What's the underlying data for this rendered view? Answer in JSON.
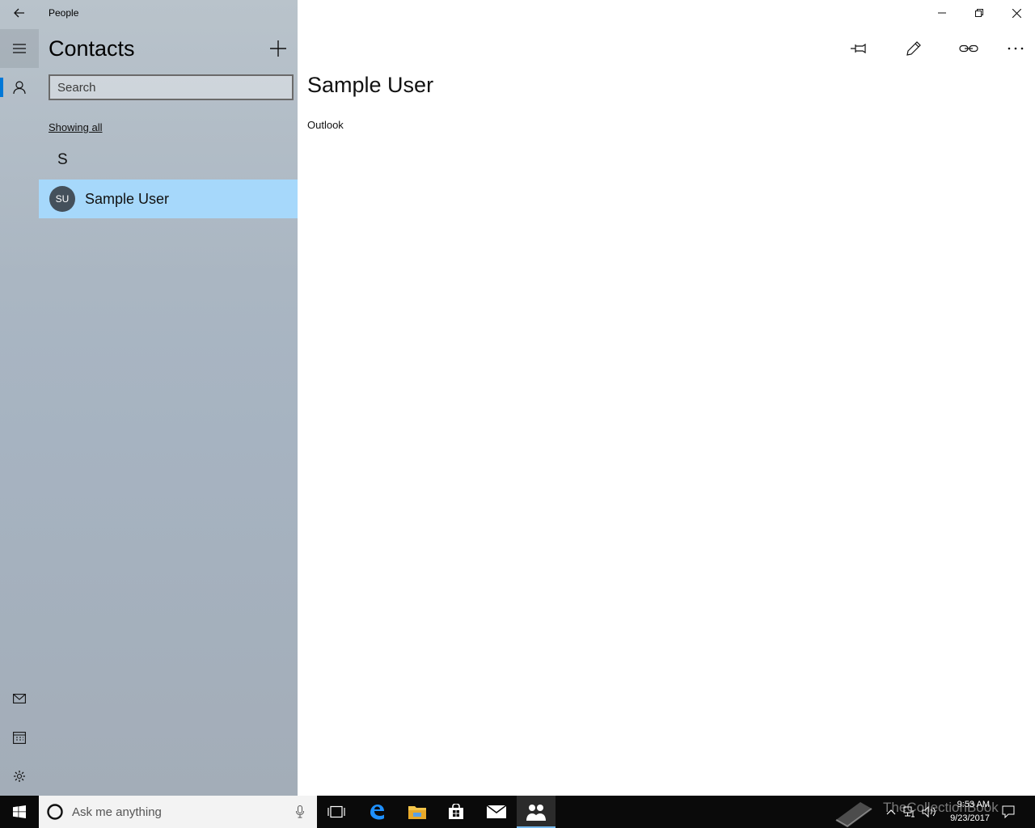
{
  "app": {
    "title": "People"
  },
  "sidebar": {
    "heading": "Contacts",
    "search_placeholder": "Search",
    "filter_label": "Showing all",
    "groups": [
      {
        "letter": "S",
        "contacts": [
          {
            "initials": "SU",
            "name": "Sample User",
            "selected": true
          }
        ]
      }
    ],
    "nav_icons": [
      "back-arrow-icon",
      "hamburger-icon",
      "person-icon",
      "mail-icon",
      "calendar-icon",
      "gear-icon"
    ]
  },
  "detail": {
    "name": "Sample User",
    "source": "Outlook",
    "toolbar_icons": [
      "pin-icon",
      "edit-pencil-icon",
      "link-icon",
      "more-icon"
    ]
  },
  "taskbar": {
    "search_placeholder": "Ask me anything",
    "time": "9:53 AM",
    "date": "9/23/2017",
    "watermark": "TheCollectionBook",
    "apps": [
      "task-view-icon",
      "edge-icon",
      "file-explorer-icon",
      "store-icon",
      "mail-icon",
      "people-icon"
    ]
  },
  "colors": {
    "accent": "#0078d7",
    "selection": "#a6d8fb",
    "avatar": "#44505b",
    "taskbar": "#0a0a0a"
  }
}
